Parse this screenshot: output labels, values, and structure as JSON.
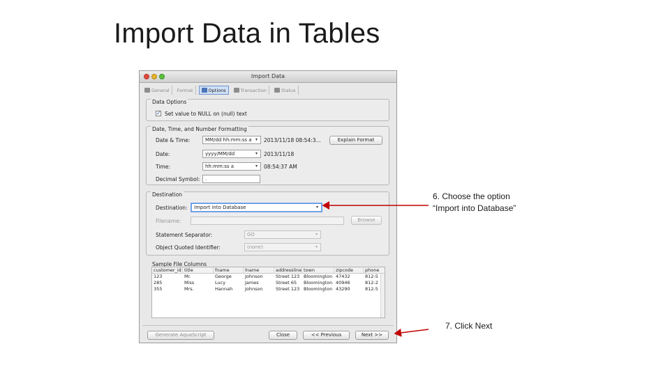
{
  "slide": {
    "title": "Import Data in Tables"
  },
  "window": {
    "title": "Import Data"
  },
  "tabs": [
    {
      "label": "General"
    },
    {
      "label": "Format"
    },
    {
      "label": "Options"
    },
    {
      "label": "Transaction"
    },
    {
      "label": "Status"
    }
  ],
  "data_options": {
    "group_label": "Data Options",
    "null_checkbox_label": "Set value to NULL on (null) text",
    "null_checked": true
  },
  "formatting": {
    "group_label": "Date, Time, and Number Formatting",
    "datetime_label": "Date & Time:",
    "datetime_value": "MM/dd hh:mm:ss a",
    "datetime_preview": "2013/11/18 08:54:3...",
    "explain_button": "Explain Format",
    "date_label": "Date:",
    "date_value": "yyyy/MM/dd",
    "date_preview": "2013/11/18",
    "time_label": "Time:",
    "time_value": "hh:mm:ss a",
    "time_preview": "08:54:37 AM",
    "decimal_label": "Decimal Symbol:",
    "decimal_value": "."
  },
  "destination": {
    "group_label": "Destination",
    "destination_label": "Destination:",
    "destination_value": "Import into Database",
    "filename_label": "Filename:",
    "filename_value": "",
    "browse_button": "Browse",
    "separator_label": "Statement Separator:",
    "separator_value": "GO",
    "quoted_label": "Object Quoted Identifier:",
    "quoted_value": "(none)"
  },
  "sample": {
    "label": "Sample File Columns",
    "columns": [
      "customer_id",
      "title",
      "fname",
      "lname",
      "addressline",
      "town",
      "zipcode",
      "phone"
    ],
    "rows": [
      [
        "123",
        "Mr.",
        "George",
        "Johnson",
        "Street 123",
        "Bloomington",
        "47432",
        "812-5"
      ],
      [
        "285",
        "Miss",
        "Lucy",
        "James",
        "Street 65",
        "Bloomington",
        "40946",
        "812-2"
      ],
      [
        "355",
        "Mrs.",
        "Hannah",
        "Johnson",
        "Street 123",
        "Bloomington",
        "43290",
        "812-5"
      ]
    ]
  },
  "footer": {
    "generate_button": "Generate AquaScript",
    "close_button": "Close",
    "previous_button": "<< Previous",
    "next_button": "Next >>"
  },
  "annotations": {
    "step6_line1": "6. Choose the option",
    "step6_line2": "“Import into Database”",
    "step7": "7. Click Next",
    "arrow_color": "#c00000"
  }
}
